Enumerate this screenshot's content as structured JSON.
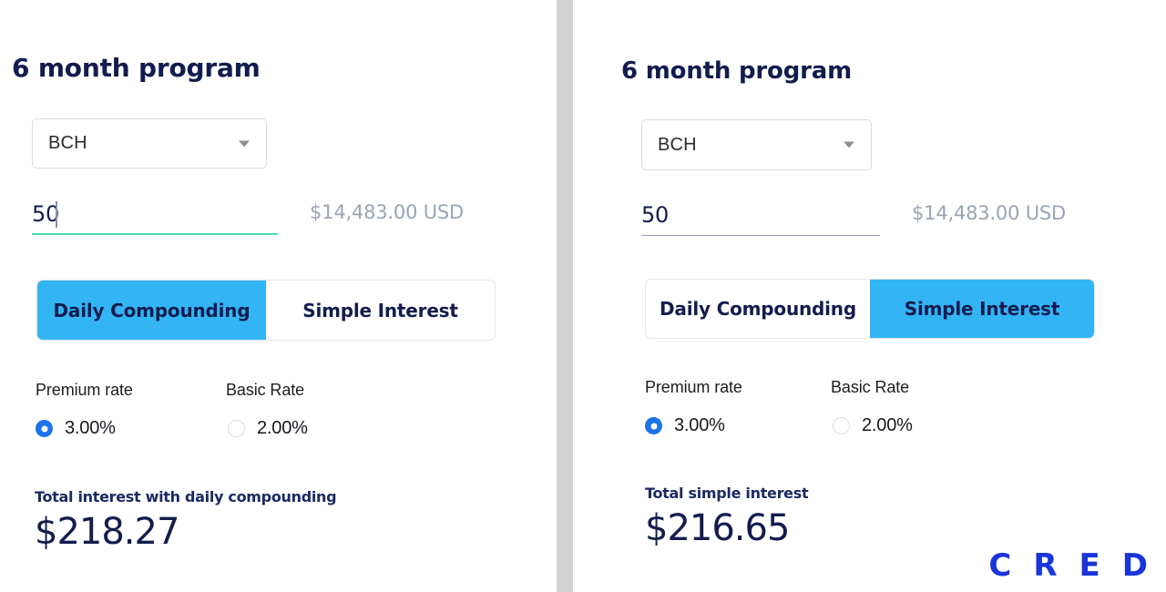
{
  "theme": {
    "navy": "#121c4e",
    "accent_blue": "#33b5f5",
    "radio_blue": "#1a73e8",
    "underline_green": "#4bdfa8",
    "muted_gray": "#9aa4b5",
    "divider_gray": "#d2d2d2",
    "brand_blue": "#1a35d8"
  },
  "panels": [
    {
      "title": "6 month program",
      "currency_select": {
        "value": "BCH",
        "arrow_icon": "chevron-down-icon"
      },
      "amount": {
        "value": "50",
        "caret_visible": true,
        "underline_color": "#4bdfa8",
        "converted": "$14,483.00 USD"
      },
      "toggle": {
        "options": [
          "Daily Compounding",
          "Simple Interest"
        ],
        "active_index": 0
      },
      "rates": {
        "headers": [
          "Premium rate",
          "Basic Rate"
        ],
        "options": [
          {
            "label": "3.00%",
            "selected": true
          },
          {
            "label": "2.00%",
            "selected": false
          }
        ]
      },
      "total": {
        "caption": "Total interest with daily compounding",
        "amount": "$218.27"
      }
    },
    {
      "title": "6 month program",
      "currency_select": {
        "value": "BCH",
        "arrow_icon": "chevron-down-icon"
      },
      "amount": {
        "value": "50",
        "caret_visible": false,
        "underline_color": "#9aa0b4",
        "converted": "$14,483.00 USD"
      },
      "toggle": {
        "options": [
          "Daily Compounding",
          "Simple Interest"
        ],
        "active_index": 1
      },
      "rates": {
        "headers": [
          "Premium rate",
          "Basic Rate"
        ],
        "options": [
          {
            "label": "3.00%",
            "selected": true
          },
          {
            "label": "2.00%",
            "selected": false
          }
        ]
      },
      "total": {
        "caption": "Total simple interest",
        "amount": "$216.65"
      }
    }
  ],
  "brand": {
    "letters": [
      "C",
      "R",
      "E",
      "D"
    ]
  }
}
